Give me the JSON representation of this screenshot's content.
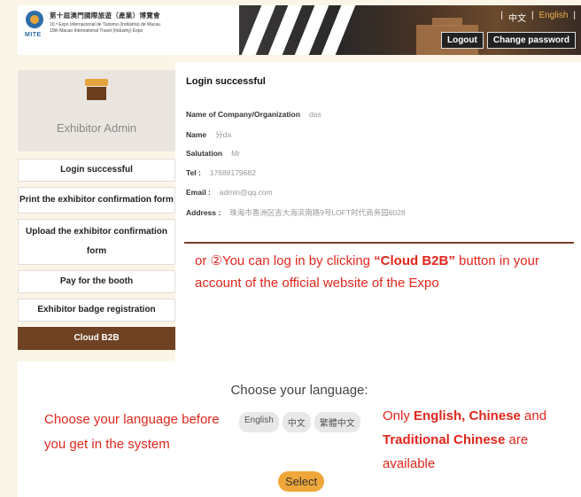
{
  "header": {
    "logo_mark_text": "MITE",
    "logo_line1": "第十屆澳門國際旅遊（產業）博覽會",
    "logo_line2": "10.ª Expo Internacional de Turismo (Indústria) de Macau",
    "logo_line3": "10th Macao International Travel (Industry) Expo",
    "lang_chinese": "中文",
    "lang_english": "English",
    "lang_sep": "|",
    "logout_label": "Logout",
    "change_password_label": "Change password"
  },
  "sidebar": {
    "title": "Exhibitor Admin",
    "items": [
      {
        "label": "Login successful"
      },
      {
        "label": "Print the exhibitor confirmation form"
      },
      {
        "label": "Upload the exhibitor confirmation form"
      },
      {
        "label": "Pay for the booth"
      },
      {
        "label": "Exhibitor badge registration"
      },
      {
        "label": "Cloud B2B"
      }
    ]
  },
  "main": {
    "title": "Login successful",
    "fields": [
      {
        "label": "Name of Company/Organization",
        "value": "das"
      },
      {
        "label": "Name",
        "value": "分da"
      },
      {
        "label": "Salutation",
        "value": "Mr"
      },
      {
        "label": "Tel :",
        "value": "17688179682"
      },
      {
        "label": "Email :",
        "value": "admin@qq.com"
      },
      {
        "label": "Address :",
        "value": "珠海市香洲区吉大海滨南路9号LOFT时代商务园6028"
      }
    ],
    "note_part1": "or ②You can log in by clicking ",
    "note_bold": "“Cloud B2B”",
    "note_part2": " button in your account of the official website of the Expo"
  },
  "language_picker": {
    "title": "Choose your language:",
    "options": [
      "English",
      "中文",
      "繁體中文"
    ],
    "select_label": "Select",
    "left_note": "Choose your language before you get in the system",
    "right_note_pre": "Only ",
    "right_note_b1": "English, Chinese",
    "right_note_mid": " and ",
    "right_note_b2": "Traditional Chinese",
    "right_note_post": " are available"
  },
  "colors": {
    "accent_red": "#e1261c",
    "brown": "#6e4223",
    "orange": "#f0a73a"
  }
}
